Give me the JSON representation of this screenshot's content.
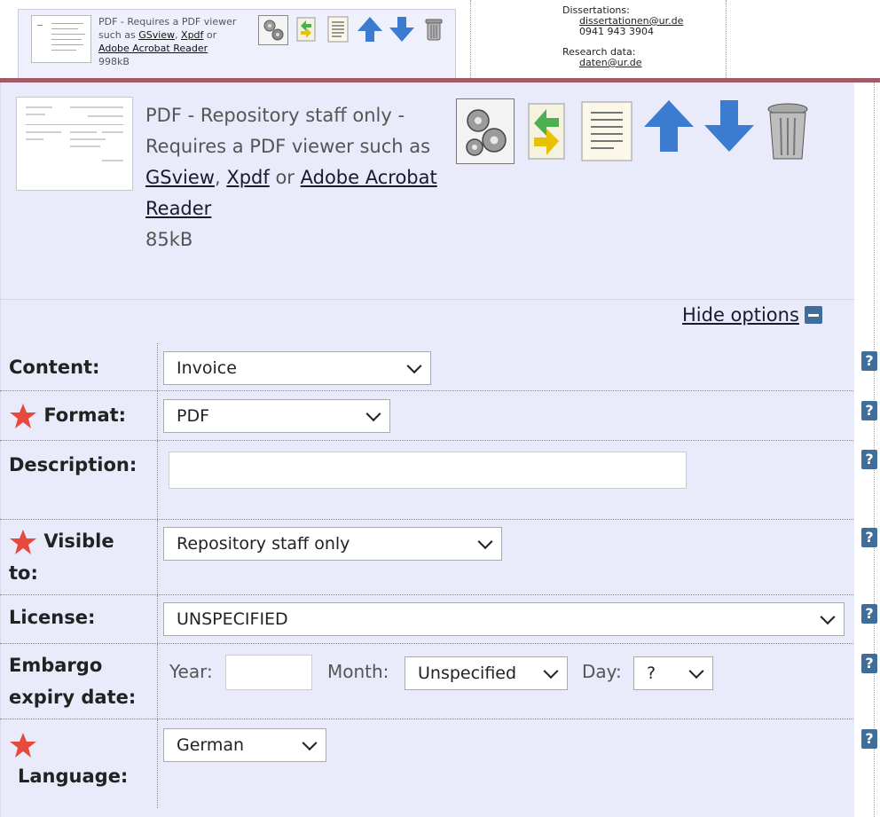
{
  "top_document": {
    "format_text": "PDF - Requires a PDF viewer such as ",
    "link_gsview": "GSview",
    "separator1": ", ",
    "link_xpdf": "Xpdf",
    "separator2": " or",
    "link_acrobat": "Adobe Acrobat Reader",
    "size": "998kB"
  },
  "contact": {
    "dissertations_label": "Dissertations:",
    "dissertations_email": "dissertationen@ur.de",
    "dissertations_phone": "0941 943 3904",
    "research_label": "Research data:",
    "research_email": "daten@ur.de"
  },
  "document": {
    "format_text": "PDF",
    "visibility_text": " - Repository staff only - Requires a PDF viewer such as ",
    "link_gsview": "GSview",
    "separator1": ", ",
    "link_xpdf": "Xpdf",
    "separator2": " or ",
    "link_acrobat": "Adobe Acrobat Reader",
    "size": "85kB",
    "icons": [
      "gears-icon",
      "replace-file-icon",
      "text-list-icon",
      "arrow-up-icon",
      "arrow-down-icon",
      "trash-can-icon"
    ]
  },
  "hide_options_label": "Hide options",
  "form": {
    "content": {
      "label": "Content:",
      "value": "Invoice"
    },
    "format": {
      "label": "Format:",
      "value": "PDF"
    },
    "description": {
      "label": "Description:",
      "value": ""
    },
    "visible_to": {
      "label_line1": "Visible",
      "label_line2": "to:",
      "value": "Repository staff only"
    },
    "license": {
      "label": "License:",
      "value": "UNSPECIFIED"
    },
    "embargo": {
      "label_line1": "Embargo",
      "label_line2": "expiry date:",
      "year_label": "Year:",
      "year_value": "",
      "month_label": "Month:",
      "month_value": "Unspecified",
      "day_label": "Day:",
      "day_value": "?"
    },
    "language": {
      "label": "Language:",
      "value": "German"
    },
    "help_symbol": "?"
  },
  "colors": {
    "panel_bg": "#e9ebfb",
    "divider_bar": "#a45a64",
    "icon_blue": "#3f6e9c",
    "arrow_blue": "#3b7bd0",
    "required_star": "#e8493e"
  }
}
